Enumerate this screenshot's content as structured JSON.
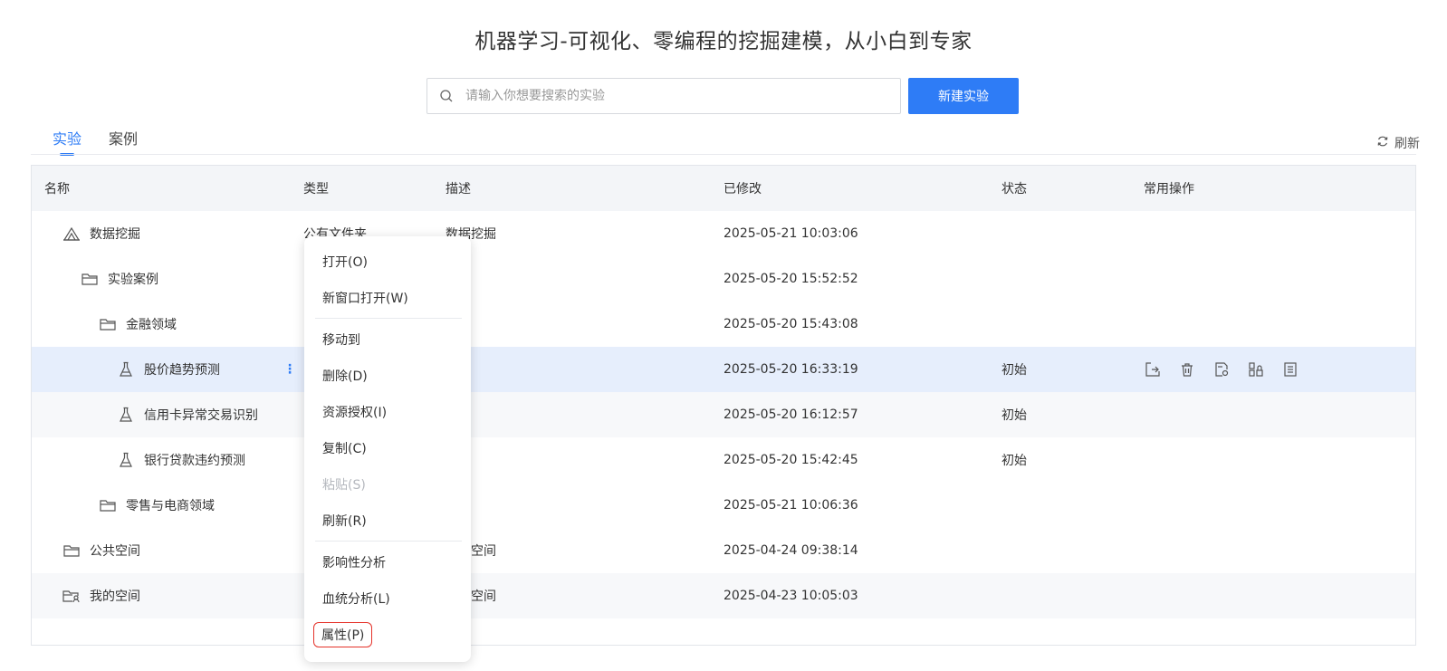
{
  "page_title": "机器学习-可视化、零编程的挖掘建模，从小白到专家",
  "search": {
    "placeholder": "请输入你想要搜索的实验",
    "value": ""
  },
  "new_button": "新建实验",
  "tabs": [
    {
      "label": "实验",
      "active": true
    },
    {
      "label": "案例",
      "active": false
    }
  ],
  "refresh_label": "刷新",
  "table": {
    "headers": {
      "name": "名称",
      "type": "类型",
      "desc": "描述",
      "modified": "已修改",
      "status": "状态",
      "ops": "常用操作"
    },
    "rows": [
      {
        "name": "数据挖掘",
        "type": "公有文件夹",
        "desc": "数据挖掘",
        "modified": "2025-05-21 10:03:06",
        "status": "",
        "icon": "shared-folder-icon"
      },
      {
        "name": "实验案例",
        "type": "",
        "desc": "",
        "modified": "2025-05-20 15:52:52",
        "status": "",
        "icon": "folder-icon"
      },
      {
        "name": "金融领域",
        "type": "",
        "desc": "",
        "modified": "2025-05-20 15:43:08",
        "status": "",
        "icon": "folder-icon"
      },
      {
        "name": "股价趋势预测",
        "type": "",
        "desc": "",
        "modified": "2025-05-20 16:33:19",
        "status": "初始",
        "icon": "flask-icon",
        "selected": true
      },
      {
        "name": "信用卡异常交易识别",
        "type": "",
        "desc": "",
        "modified": "2025-05-20 16:12:57",
        "status": "初始",
        "icon": "flask-icon"
      },
      {
        "name": "银行贷款违约预测",
        "type": "",
        "desc": "",
        "modified": "2025-05-20 15:42:45",
        "status": "初始",
        "icon": "flask-icon"
      },
      {
        "name": "零售与电商领域",
        "type": "",
        "desc": "",
        "modified": "2025-05-21 10:06:36",
        "status": "",
        "icon": "folder-icon"
      },
      {
        "name": "公共空间",
        "type": "",
        "desc": "公共空间",
        "modified": "2025-04-24 09:38:14",
        "status": "",
        "icon": "folder-icon"
      },
      {
        "name": "我的空间",
        "type": "",
        "desc": "我的空间",
        "modified": "2025-04-23 10:05:03",
        "status": "",
        "icon": "user-folder-icon"
      }
    ]
  },
  "context_menu": {
    "items": [
      {
        "label": "打开(O)"
      },
      {
        "label": "新窗口打开(W)"
      },
      {
        "label": "移动到"
      },
      {
        "label": "删除(D)"
      },
      {
        "label": "资源授权(I)"
      },
      {
        "label": "复制(C)"
      },
      {
        "label": "粘贴(S)",
        "disabled": true
      },
      {
        "label": "刷新(R)"
      },
      {
        "label": "影响性分析"
      },
      {
        "label": "血统分析(L)"
      },
      {
        "label": "属性(P)",
        "highlighted": true
      }
    ]
  },
  "colors": {
    "accent": "#2e7cf6",
    "selected_row": "#e6eefc",
    "highlight_border": "#e5332a"
  }
}
